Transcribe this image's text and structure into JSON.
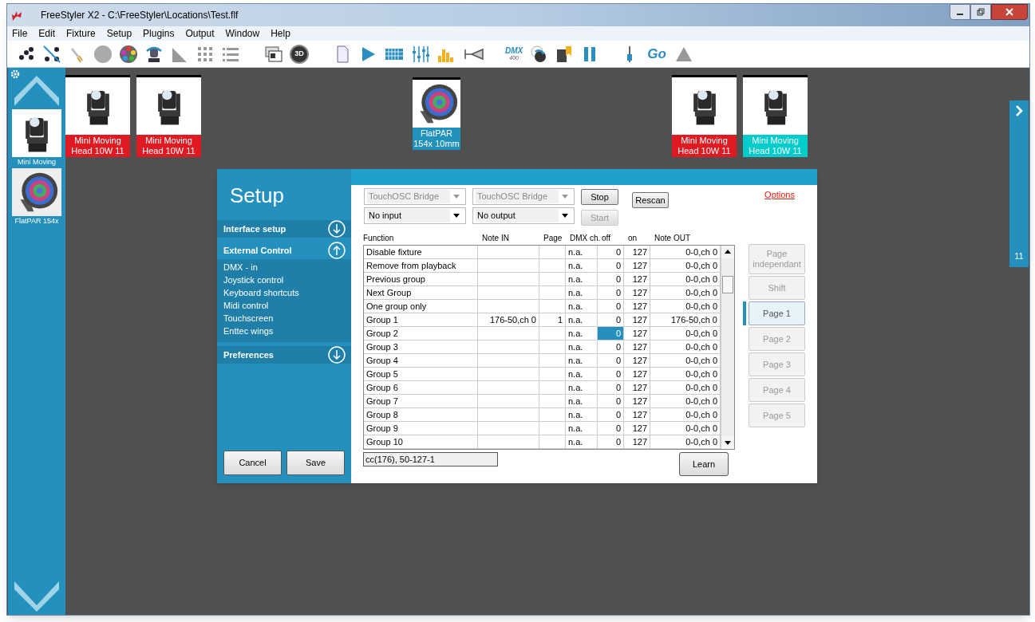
{
  "window": {
    "title": "FreeStyler X2  -  C:\\FreeStyler\\Locations\\Test.flf"
  },
  "menu": [
    "File",
    "Edit",
    "Fixture",
    "Setup",
    "Plugins",
    "Output",
    "Window",
    "Help"
  ],
  "toolbar": {
    "view_3d": "3D",
    "dmx": "DMX",
    "dmx_sub": "400",
    "go": "Go"
  },
  "sidebar": {
    "items": [
      {
        "label": "Mini Moving",
        "kind": "moving-head"
      },
      {
        "label": "FlatPAR 154x",
        "kind": "par"
      }
    ]
  },
  "canvas": {
    "fixtures": [
      {
        "label": "Mini Moving Head 10W 11",
        "kind": "moving-head",
        "color": "#e01a22"
      },
      {
        "label": "Mini Moving Head 10W 11",
        "kind": "moving-head",
        "color": "#e01a22"
      },
      {
        "label": "FlatPAR 154x 10mm",
        "kind": "par",
        "color": "#2191bd"
      },
      {
        "label": "Mini Moving Head 10W 11",
        "kind": "moving-head",
        "color": "#e01a22"
      },
      {
        "label": "Mini Moving Head 10W 11",
        "kind": "moving-head",
        "color": "#00cccc"
      }
    ],
    "side_tab": "11"
  },
  "setup": {
    "title": "Setup",
    "sections": [
      {
        "label": "Interface setup",
        "expanded": false
      },
      {
        "label": "External Control",
        "expanded": true,
        "items": [
          "DMX - in",
          "Joystick control",
          "Keyboard shortcuts",
          "Midi control",
          "Touchscreen",
          "Enttec wings"
        ]
      },
      {
        "label": "Preferences",
        "expanded": false
      }
    ],
    "cancel": "Cancel",
    "save": "Save",
    "input_device": {
      "value": "TouchOSC Bridge",
      "disabled": true
    },
    "output_device": {
      "value": "TouchOSC Bridge",
      "disabled": true
    },
    "input_port": {
      "value": "No input",
      "disabled": false
    },
    "output_port": {
      "value": "No output",
      "disabled": false
    },
    "stop": {
      "label": "Stop",
      "disabled": false
    },
    "start": {
      "label": "Start",
      "disabled": true
    },
    "rescan": "Rescan",
    "options": "Options",
    "columns": [
      "Function",
      "Note IN",
      "Page",
      "DMX ch.",
      "off",
      "on",
      "Note OUT"
    ],
    "rows": [
      {
        "function": "Disable fixture",
        "note_in": "",
        "page": "",
        "dmx": "n.a.",
        "off": "0",
        "on": "127",
        "note_out": "0-0,ch 0",
        "off_selected": false
      },
      {
        "function": "Remove from playback",
        "note_in": "",
        "page": "",
        "dmx": "n.a.",
        "off": "0",
        "on": "127",
        "note_out": "0-0,ch 0",
        "off_selected": false
      },
      {
        "function": "Previous group",
        "note_in": "",
        "page": "",
        "dmx": "n.a.",
        "off": "0",
        "on": "127",
        "note_out": "0-0,ch 0",
        "off_selected": false
      },
      {
        "function": "Next Group",
        "note_in": "",
        "page": "",
        "dmx": "n.a.",
        "off": "0",
        "on": "127",
        "note_out": "0-0,ch 0",
        "off_selected": false
      },
      {
        "function": "One group only",
        "note_in": "",
        "page": "",
        "dmx": "n.a.",
        "off": "0",
        "on": "127",
        "note_out": "0-0,ch 0",
        "off_selected": false
      },
      {
        "function": "Group 1",
        "note_in": "176-50,ch 0",
        "page": "1",
        "dmx": "n.a.",
        "off": "0",
        "on": "127",
        "note_out": "176-50,ch 0",
        "off_selected": false
      },
      {
        "function": "Group 2",
        "note_in": "",
        "page": "",
        "dmx": "n.a.",
        "off": "0",
        "on": "127",
        "note_out": "0-0,ch 0",
        "off_selected": true
      },
      {
        "function": "Group 3",
        "note_in": "",
        "page": "",
        "dmx": "n.a.",
        "off": "0",
        "on": "127",
        "note_out": "0-0,ch 0",
        "off_selected": false
      },
      {
        "function": "Group 4",
        "note_in": "",
        "page": "",
        "dmx": "n.a.",
        "off": "0",
        "on": "127",
        "note_out": "0-0,ch 0",
        "off_selected": false
      },
      {
        "function": "Group 5",
        "note_in": "",
        "page": "",
        "dmx": "n.a.",
        "off": "0",
        "on": "127",
        "note_out": "0-0,ch 0",
        "off_selected": false
      },
      {
        "function": "Group 6",
        "note_in": "",
        "page": "",
        "dmx": "n.a.",
        "off": "0",
        "on": "127",
        "note_out": "0-0,ch 0",
        "off_selected": false
      },
      {
        "function": "Group 7",
        "note_in": "",
        "page": "",
        "dmx": "n.a.",
        "off": "0",
        "on": "127",
        "note_out": "0-0,ch 0",
        "off_selected": false
      },
      {
        "function": "Group 8",
        "note_in": "",
        "page": "",
        "dmx": "n.a.",
        "off": "0",
        "on": "127",
        "note_out": "0-0,ch 0",
        "off_selected": false
      },
      {
        "function": "Group 9",
        "note_in": "",
        "page": "",
        "dmx": "n.a.",
        "off": "0",
        "on": "127",
        "note_out": "0-0,ch 0",
        "off_selected": false
      },
      {
        "function": "Group 10",
        "note_in": "",
        "page": "",
        "dmx": "n.a.",
        "off": "0",
        "on": "127",
        "note_out": "0-0,ch 0",
        "off_selected": false
      }
    ],
    "message": "cc(176), 50-127-1",
    "learn": "Learn",
    "pages": [
      {
        "label": "Page independant",
        "selected": false
      },
      {
        "label": "Shift",
        "selected": false
      },
      {
        "label": "Page 1",
        "selected": true
      },
      {
        "label": "Page 2",
        "selected": false
      },
      {
        "label": "Page 3",
        "selected": false
      },
      {
        "label": "Page 4",
        "selected": false
      },
      {
        "label": "Page 5",
        "selected": false
      }
    ]
  }
}
